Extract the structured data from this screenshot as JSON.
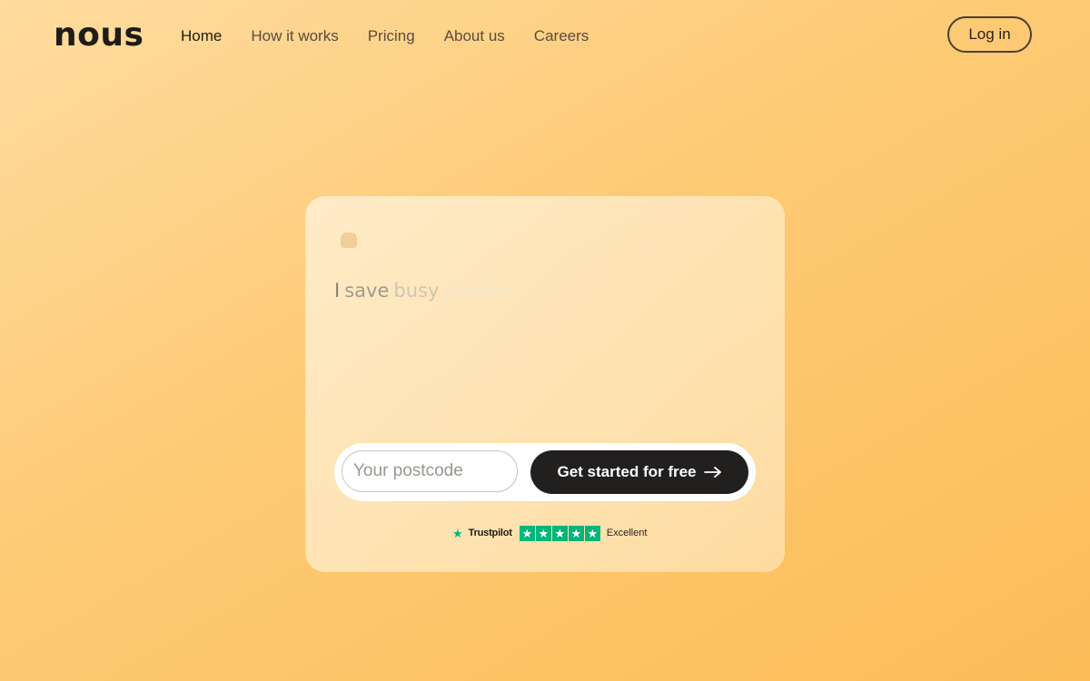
{
  "brand": {
    "logo_text": "nous"
  },
  "nav": {
    "links": [
      {
        "label": "Home",
        "active": true
      },
      {
        "label": "How it works"
      },
      {
        "label": "Pricing"
      },
      {
        "label": "About us"
      },
      {
        "label": "Careers"
      }
    ],
    "login_label": "Log in"
  },
  "hero": {
    "headline_words": [
      "I",
      "save",
      "busy",
      "people"
    ],
    "postcode_placeholder": "Your postcode",
    "cta_label": "Get started for free",
    "cta_icon": "arrow-right-icon"
  },
  "trustpilot": {
    "brand": "Trustpilot",
    "rating_text": "Excellent",
    "stars": 5,
    "color": "#00b67a"
  },
  "colors": {
    "background_start": "#ffdc9f",
    "background_end": "#fcbd58",
    "cta_background": "#221f1f",
    "text_dark": "#1f1b18"
  }
}
